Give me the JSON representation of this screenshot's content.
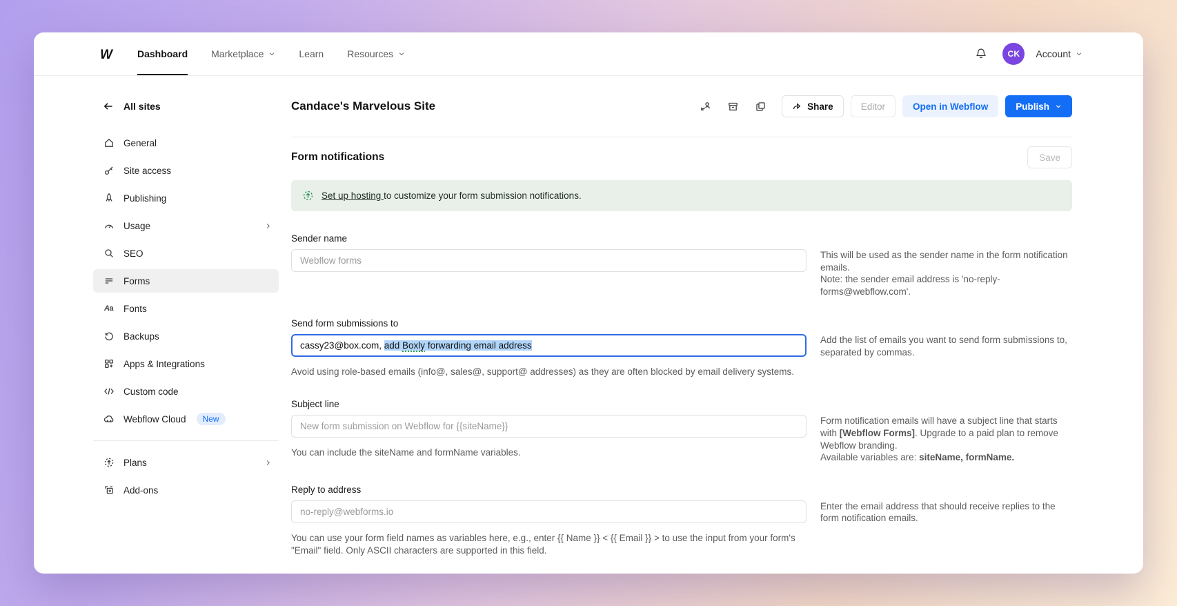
{
  "colors": {
    "accent_blue": "#146EF5",
    "avatar_purple": "#7A45E0",
    "selection_blue": "#B0D5F9",
    "banner_green_bg": "#E8F0E9",
    "banner_icon_green": "#2F8F54"
  },
  "topnav": {
    "items": [
      {
        "label": "Dashboard"
      },
      {
        "label": "Marketplace"
      },
      {
        "label": "Learn"
      },
      {
        "label": "Resources"
      }
    ],
    "avatar_initials": "CK",
    "account_label": "Account"
  },
  "sidebar": {
    "back_label": "All sites",
    "items": [
      {
        "label": "General"
      },
      {
        "label": "Site access"
      },
      {
        "label": "Publishing"
      },
      {
        "label": "Usage"
      },
      {
        "label": "SEO"
      },
      {
        "label": "Forms"
      },
      {
        "label": "Fonts"
      },
      {
        "label": "Backups"
      },
      {
        "label": "Apps & Integrations"
      },
      {
        "label": "Custom code"
      },
      {
        "label": "Webflow Cloud",
        "badge": "New"
      }
    ],
    "footer_items": [
      {
        "label": "Plans"
      },
      {
        "label": "Add-ons"
      }
    ]
  },
  "site_header": {
    "title": "Candace's Marvelous Site",
    "share_label": "Share",
    "editor_label": "Editor",
    "open_webflow_label": "Open in Webflow",
    "publish_label": "Publish"
  },
  "page": {
    "title": "Form notifications",
    "save_label": "Save",
    "banner": {
      "link_text": "Set up hosting ",
      "rest_text": "to customize your form submission notifications."
    },
    "sender": {
      "label": "Sender name",
      "placeholder": "Webflow forms",
      "help_line1": "This will be used as the sender name in the form notification emails.",
      "help_line2": "Note: the sender email address is 'no-reply-forms@webflow.com'."
    },
    "send_to": {
      "label": "Send form submissions to",
      "value_prefix": "cassy23@box.com, ",
      "selected_part1": "add ",
      "selected_word": "Boxly",
      "selected_part2": " forwarding email address",
      "help_below": "Avoid using role-based emails (info@, sales@, support@ addresses) as they are often blocked by email delivery systems.",
      "help_right": "Add the list of emails you want to send form submissions to, separated by commas."
    },
    "subject": {
      "label": "Subject line",
      "placeholder": "New form submission on Webflow for {{siteName}}",
      "help_below": "You can include the siteName and formName variables.",
      "help_right_p1": "Form notification emails will have a subject line that starts with ",
      "help_right_b1": "[Webflow Forms]",
      "help_right_p2": ". Upgrade to a paid plan to remove Webflow branding.",
      "help_right_p3": "Available variables are: ",
      "help_right_b2": "siteName, formName."
    },
    "reply": {
      "label": "Reply to address",
      "placeholder": "no-reply@webforms.io",
      "help_below": "You can use your form field names as variables here, e.g., enter {{ Name }} < {{ Email }} > to use the input from your form's \"Email\" field. Only ASCII characters are supported in this field.",
      "help_right": "Enter the email address that should receive replies to the form notification emails."
    }
  }
}
